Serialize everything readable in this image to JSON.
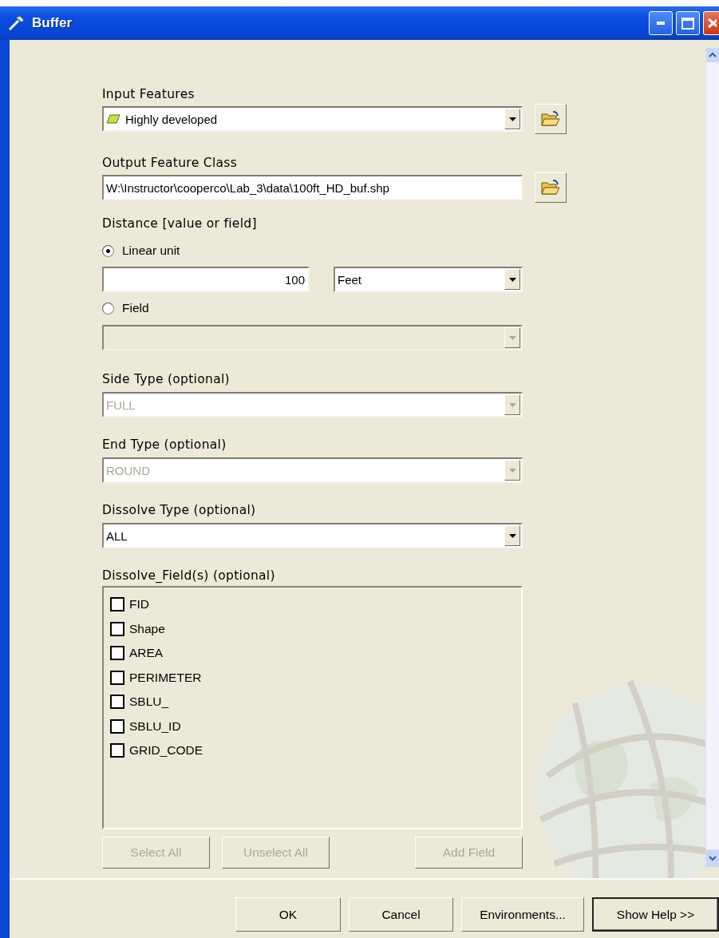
{
  "window": {
    "title": "Buffer"
  },
  "input_features": {
    "label": "Input Features",
    "value": "Highly developed"
  },
  "output_feature_class": {
    "label": "Output Feature Class",
    "value": "W:\\Instructor\\cooperco\\Lab_3\\data\\100ft_HD_buf.shp"
  },
  "distance": {
    "label": "Distance [value or field]",
    "options": [
      {
        "label": "Linear unit",
        "selected": true
      },
      {
        "label": "Field",
        "selected": false
      }
    ],
    "linear_value": "100",
    "unit": "Feet",
    "field": {
      "disabled": true
    }
  },
  "side_type": {
    "label": "Side Type (optional)",
    "value": "FULL",
    "disabled": true
  },
  "end_type": {
    "label": "End Type (optional)",
    "value": "ROUND",
    "disabled": true
  },
  "dissolve_type": {
    "label": "Dissolve Type (optional)",
    "value": "ALL",
    "disabled": false
  },
  "dissolve_fields": {
    "label": "Dissolve_Field(s) (optional)",
    "items": [
      {
        "label": "FID",
        "checked": false
      },
      {
        "label": "Shape",
        "checked": false
      },
      {
        "label": "AREA",
        "checked": false
      },
      {
        "label": "PERIMETER",
        "checked": false
      },
      {
        "label": "SBLU_",
        "checked": false
      },
      {
        "label": "SBLU_ID",
        "checked": false
      },
      {
        "label": "GRID_CODE",
        "checked": false
      }
    ],
    "buttons": [
      {
        "label": "Select All",
        "disabled": true
      },
      {
        "label": "Unselect All",
        "disabled": true
      },
      {
        "label": "Add Field",
        "disabled": true
      }
    ]
  },
  "footer_buttons": [
    {
      "label": "OK",
      "default": false
    },
    {
      "label": "Cancel",
      "default": false
    },
    {
      "label": "Environments...",
      "default": false
    },
    {
      "label": "Show Help >>",
      "default": true
    }
  ]
}
